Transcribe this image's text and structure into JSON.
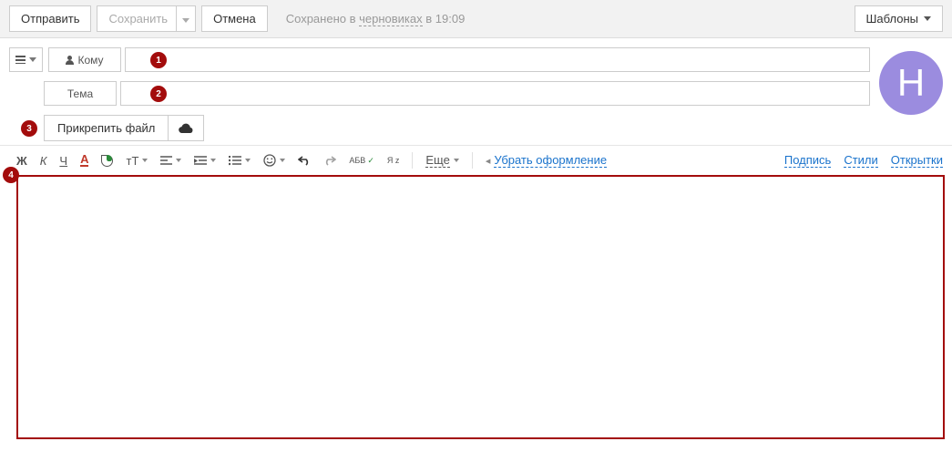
{
  "top": {
    "send": "Отправить",
    "save": "Сохранить",
    "cancel": "Отмена",
    "status_prefix": "Сохранено в ",
    "status_link": "черновиках",
    "status_suffix": " в 19:09",
    "templates": "Шаблоны"
  },
  "fields": {
    "to_label": "Кому",
    "subject_label": "Тема",
    "attach_label": "Прикрепить файл"
  },
  "avatar": {
    "letter": "Н"
  },
  "editor": {
    "bold": "Ж",
    "italic": "К",
    "underline": "Ч",
    "color_a": "А",
    "font_size": "тТ",
    "spell": "АБВ",
    "translit": "Я z",
    "more": "Еще",
    "clear_format": "Убрать оформление",
    "signature": "Подпись",
    "styles": "Стили",
    "cards": "Открытки"
  },
  "annot": {
    "1": "1",
    "2": "2",
    "3": "3",
    "4": "4"
  }
}
